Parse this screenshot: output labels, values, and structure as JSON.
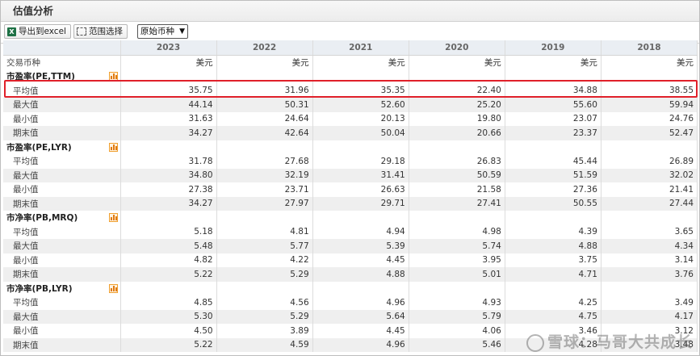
{
  "title": "估值分析",
  "toolbar": {
    "export_label": "导出到excel",
    "range_label": "范围选择",
    "currency_selected": "原始币种"
  },
  "header": {
    "years": [
      "2023",
      "2022",
      "2021",
      "2020",
      "2019",
      "2018"
    ],
    "currency_row_label": "交易币种",
    "currency_values": [
      "美元",
      "美元",
      "美元",
      "美元",
      "美元",
      "美元"
    ]
  },
  "sections": [
    {
      "title": "市盈率(PE,TTM)",
      "rows": [
        {
          "label": "平均值",
          "values": [
            "35.75",
            "31.96",
            "35.35",
            "22.40",
            "34.88",
            "38.55"
          ]
        },
        {
          "label": "最大值",
          "values": [
            "44.14",
            "50.31",
            "52.60",
            "25.20",
            "55.60",
            "59.94"
          ]
        },
        {
          "label": "最小值",
          "values": [
            "31.63",
            "24.64",
            "20.13",
            "19.80",
            "23.07",
            "24.76"
          ]
        },
        {
          "label": "期末值",
          "values": [
            "34.27",
            "42.64",
            "50.04",
            "20.66",
            "23.37",
            "52.47"
          ]
        }
      ]
    },
    {
      "title": "市盈率(PE,LYR)",
      "rows": [
        {
          "label": "平均值",
          "values": [
            "31.78",
            "27.68",
            "29.18",
            "26.83",
            "45.44",
            "26.89"
          ]
        },
        {
          "label": "最大值",
          "values": [
            "34.80",
            "32.19",
            "31.41",
            "50.59",
            "51.59",
            "32.02"
          ]
        },
        {
          "label": "最小值",
          "values": [
            "27.38",
            "23.71",
            "26.63",
            "21.58",
            "27.36",
            "21.41"
          ]
        },
        {
          "label": "期末值",
          "values": [
            "34.27",
            "27.97",
            "29.71",
            "27.41",
            "50.55",
            "27.44"
          ]
        }
      ]
    },
    {
      "title": "市净率(PB,MRQ)",
      "rows": [
        {
          "label": "平均值",
          "values": [
            "5.18",
            "4.81",
            "4.94",
            "4.98",
            "4.39",
            "3.65"
          ]
        },
        {
          "label": "最大值",
          "values": [
            "5.48",
            "5.77",
            "5.39",
            "5.74",
            "4.88",
            "4.34"
          ]
        },
        {
          "label": "最小值",
          "values": [
            "4.82",
            "4.22",
            "4.45",
            "3.95",
            "3.75",
            "3.14"
          ]
        },
        {
          "label": "期末值",
          "values": [
            "5.22",
            "5.29",
            "4.88",
            "5.01",
            "4.71",
            "3.76"
          ]
        }
      ]
    },
    {
      "title": "市净率(PB,LYR)",
      "rows": [
        {
          "label": "平均值",
          "values": [
            "4.85",
            "4.56",
            "4.96",
            "4.93",
            "4.25",
            "3.49"
          ]
        },
        {
          "label": "最大值",
          "values": [
            "5.30",
            "5.29",
            "5.64",
            "5.79",
            "4.75",
            "4.17"
          ]
        },
        {
          "label": "最小值",
          "values": [
            "4.50",
            "3.89",
            "4.45",
            "4.06",
            "3.46",
            "3.12"
          ]
        },
        {
          "label": "期末值",
          "values": [
            "5.22",
            "4.59",
            "4.96",
            "5.46",
            "4.28",
            "3.48"
          ]
        }
      ]
    }
  ],
  "watermark": "雪球：马哥大共成长"
}
